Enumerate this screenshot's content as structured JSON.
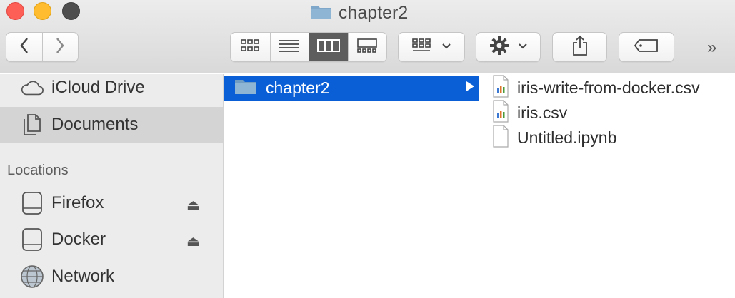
{
  "window": {
    "title": "chapter2",
    "title_icon": "folder-icon"
  },
  "toolbar": {
    "back_icon": "chevron-left-icon",
    "forward_icon": "chevron-right-icon",
    "view_modes": [
      {
        "name": "icon-view",
        "icon": "grid-icon",
        "active": false
      },
      {
        "name": "list-view",
        "icon": "list-icon",
        "active": false
      },
      {
        "name": "column-view",
        "icon": "columns-icon",
        "active": true
      },
      {
        "name": "gallery-view",
        "icon": "gallery-icon",
        "active": false
      }
    ],
    "group_icon": "group-grid-icon",
    "action_icon": "gear-icon",
    "share_icon": "share-icon",
    "tag_icon": "tag-icon",
    "overflow_label": "»"
  },
  "sidebar": {
    "favorites": [
      {
        "label": "iCloud Drive",
        "icon": "cloud-icon",
        "selected": false
      },
      {
        "label": "Documents",
        "icon": "documents-icon",
        "selected": true
      }
    ],
    "locations_heading": "Locations",
    "locations": [
      {
        "label": "Firefox",
        "icon": "drive-icon",
        "eject": true
      },
      {
        "label": "Docker",
        "icon": "drive-icon",
        "eject": true
      },
      {
        "label": "Network",
        "icon": "globe-icon",
        "eject": false
      }
    ],
    "eject_symbol": "⏏"
  },
  "columns": {
    "column1": [
      {
        "label": "chapter2",
        "icon": "folder-icon",
        "selected": true,
        "has_children": true
      }
    ],
    "column2": [
      {
        "label": "iris-write-from-docker.csv",
        "icon": "csv-file-icon"
      },
      {
        "label": "iris.csv",
        "icon": "csv-file-icon"
      },
      {
        "label": "Untitled.ipynb",
        "icon": "blank-file-icon"
      }
    ]
  },
  "colors": {
    "selection": "#0a5fd7",
    "folder": "#7ea7c9",
    "close": "#fd5f57",
    "minimize": "#febc2e",
    "maximize": "#4e4e4e"
  }
}
